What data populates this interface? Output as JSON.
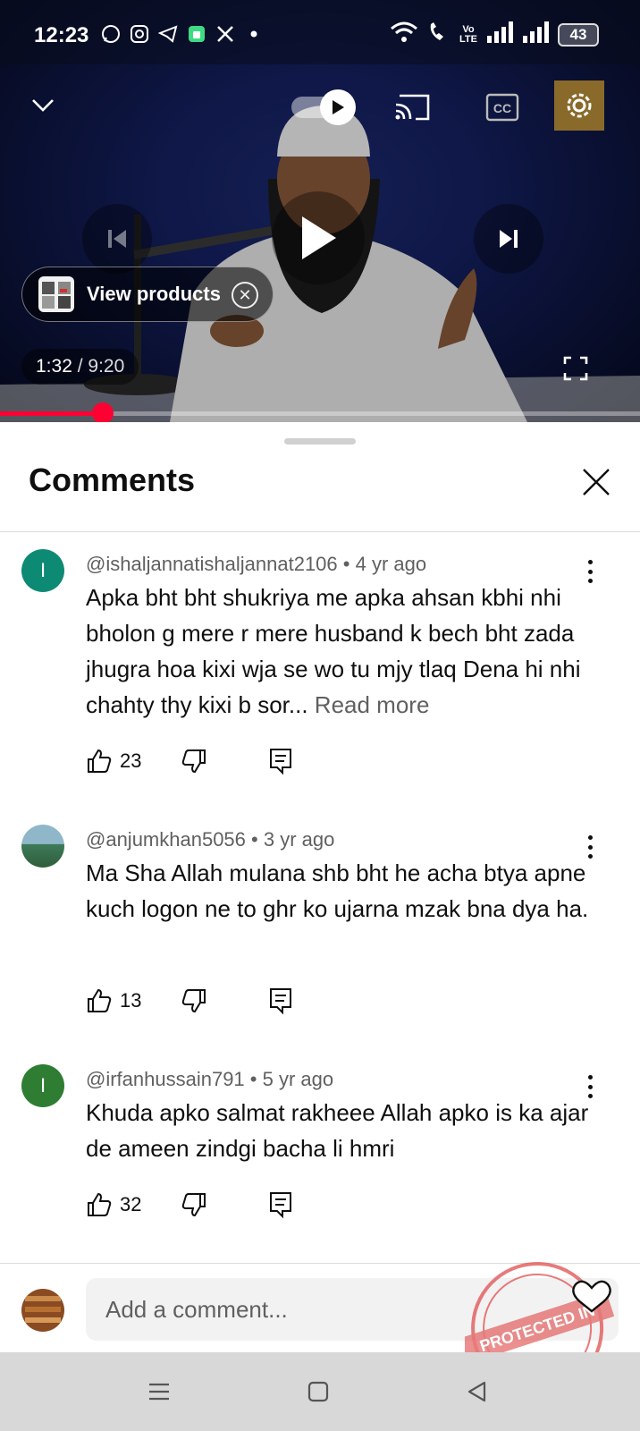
{
  "status_bar": {
    "time": "12:23",
    "notification_icons": [
      "whatsapp-icon",
      "instagram-icon",
      "telegram-icon",
      "app-icon",
      "x-icon",
      "dot-icon"
    ],
    "volte_label": "Vo\nLTE",
    "battery": "43"
  },
  "player": {
    "current_time": "1:32",
    "separator": " / ",
    "duration": "9:20",
    "progress_fraction": 0.16,
    "buffered_fraction": 0.2,
    "view_products_label": "View products",
    "accent_color": "#ff0033"
  },
  "comments_panel": {
    "title": "Comments",
    "comments": [
      {
        "avatar_letter": "I",
        "avatar_color": "#0d8a74",
        "author": "@ishaljannatishaljannat2106",
        "age": "4 yr ago",
        "text": "Apka bht bht shukriya me apka ahsan kbhi nhi bholon g mere r mere husband k bech bht zada jhugra hoa kixi wja se wo tu mjy tlaq Dena hi nhi chahty thy kixi b sor...",
        "read_more": "Read more",
        "likes": "23"
      },
      {
        "avatar_letter": "",
        "avatar_color": "#3d7a5a",
        "author": "@anjumkhan5056",
        "age": "3 yr ago",
        "text": "Ma Sha Allah mulana shb bht he acha btya apne kuch logon ne to ghr ko ujarna mzak bna dya ha.",
        "read_more": "",
        "likes": "13"
      },
      {
        "avatar_letter": "I",
        "avatar_color": "#2e7d32",
        "author": "@irfanhussain791",
        "age": "5 yr ago",
        "text": "Khuda apko salmat rakheee Allah apko is ka ajar de ameen zindgi bacha li hmri",
        "read_more": "",
        "likes": "32"
      }
    ],
    "meta_separator": " • ",
    "add_comment_placeholder": "Add a comment..."
  },
  "watermark": {
    "text": "PROTECTED IN",
    "color": "#e05050"
  }
}
